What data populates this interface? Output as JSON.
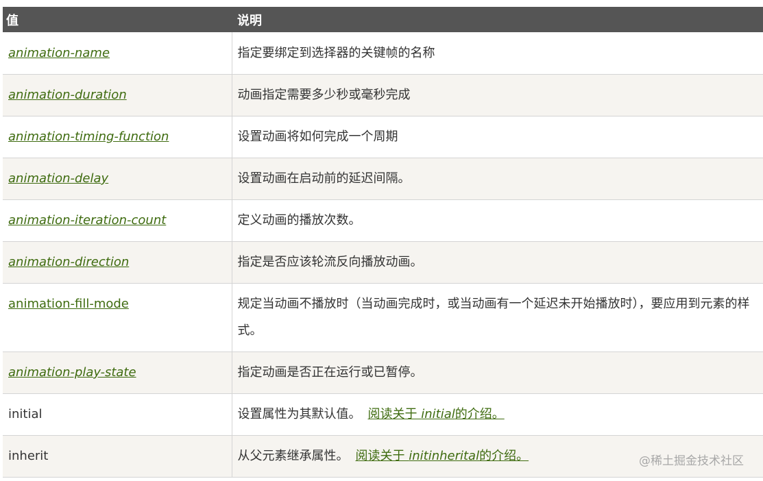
{
  "header": {
    "col_value": "值",
    "col_desc": "说明"
  },
  "rows": [
    {
      "name": "animation-name",
      "desc": "指定要绑定到选择器的关键帧的名称"
    },
    {
      "name": "animation-duration",
      "desc": "动画指定需要多少秒或毫秒完成"
    },
    {
      "name": "animation-timing-function",
      "desc": "设置动画将如何完成一个周期"
    },
    {
      "name": "animation-delay",
      "desc": "设置动画在启动前的延迟间隔。"
    },
    {
      "name": "animation-iteration-count",
      "desc": "定义动画的播放次数。"
    },
    {
      "name": "animation-direction",
      "desc": "指定是否应该轮流反向播放动画。"
    },
    {
      "name": "animation-fill-mode",
      "desc": "规定当动画不播放时（当动画完成时，或当动画有一个延迟未开始播放时），要应用到元素的样式。"
    },
    {
      "name": "animation-play-state",
      "desc": "指定动画是否正在运行或已暂停。"
    },
    {
      "name": "initial",
      "desc": "设置属性为其默认值。",
      "link_pre": "阅读关于 ",
      "link_em": "initial",
      "link_post": "的介绍。"
    },
    {
      "name": "inherit",
      "desc": "从父元素继承属性。",
      "link_pre": "阅读关于 ",
      "link_em": "initinherital",
      "link_post": "的介绍。"
    }
  ],
  "watermark": "@稀土掘金技术社区",
  "colors": {
    "header_bg": "#555555",
    "link": "#3e6b0f",
    "alt_row": "#f6f4f0"
  }
}
